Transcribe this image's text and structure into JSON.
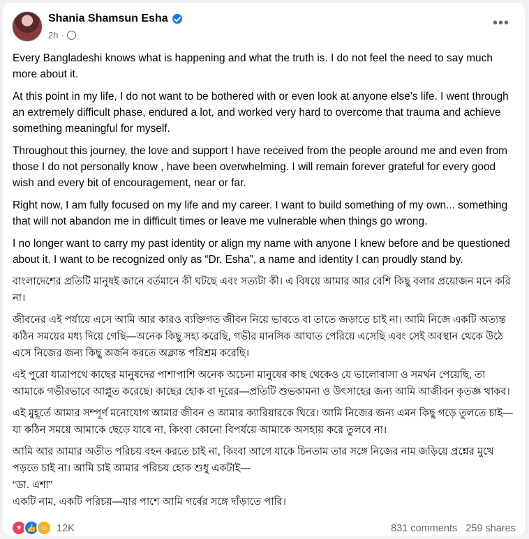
{
  "post": {
    "author": "Shania Shamsun Esha",
    "time": "2h",
    "separator": "·",
    "paragraphs_en": [
      "Every Bangladeshi knows what is happening and what the truth is. I do not feel the need to say much more about it.",
      "At this point in my life, I do not want to be bothered with or even look at anyone else’s life. I went through an extremely difficult phase, endured a lot, and worked very hard to overcome that trauma and achieve something meaningful for myself.",
      "Throughout this journey, the love and support I have received from the people around me and even from those I do not personally know , have been overwhelming. I will remain forever grateful for every good wish and every bit of encouragement, near or far.",
      "Right now, I am fully focused on my life and my career. I want to build something of my own... something that will not abandon me in difficult times or leave me vulnerable when things go wrong.",
      "I no longer want to carry my past identity or align my name with anyone I knew before  and be questioned about it. I want to be recognized only as “Dr. Esha”, a name and identity I can proudly stand by."
    ],
    "paragraphs_bn": [
      "বাংলাদেশের প্রতিটি মানুষই জানে বর্তমানে কী ঘটছে এবং সত্যটা কী। এ বিষয়ে আমার আর বেশি কিছু বলার প্রয়োজন মনে করি না।",
      "জীবনের এই পর্যায়ে এসে আমি আর কারও ব্যক্তিগত জীবন নিয়ে ভাবতে বা তাতে জড়াতে চাই না। আমি নিজে একটি অত্যন্ত কঠিন সময়ের মধ্য দিয়ে গেছি—অনেক কিছু সহ্য করেছি, গভীর মানসিক আঘাত পেরিয়ে এসেছি এবং সেই অবস্থান থেকে উঠে এসে নিজের জন্য কিছু অর্জন করতে অক্লান্ত পরিশ্রম করেছি।",
      "এই পুরো যাত্রাপথে কাছের মানুষদের পাশাপাশি অনেক অচেনা মানুষের কাছ থেকেও যে ভালোবাসা ও সমর্থন পেয়েছি, তা আমাকে গভীরভাবে আপ্লুত করেছে। কাছের হোক বা দূরের—প্রতিটি শুভকামনা ও উৎসাহের জন্য আমি আজীবন কৃতজ্ঞ থাকব।",
      "এই মুহূর্তে আমার সম্পূর্ণ মনোযোগ আমার জীবন ও আমার ক্যারিয়ারকে ঘিরে। আমি নিজের জন্য এমন কিছু গড়ে তুলতে চাই—যা কঠিন সময়ে আমাকে ছেড়ে যাবে না, কিংবা কোনো বিপর্যয়ে আমাকে অসহায় করে তুলবে না।",
      "আমি আর আমার অতীত পরিচয় বহন করতে চাই না, কিংবা আগে যাকে চিনতাম তার সঙ্গে নিজের নাম জড়িয়ে প্রশ্নের মুখে পড়তে চাই না। আমি চাই আমার পরিচয় হোক শুধু একটাই—\n“ডা. এশা”\nএকটি নাম, একটি পরিচয়—যার পাশে আমি গর্বের সঙ্গে দাঁড়াতে পারি।"
    ],
    "reaction_count": "12K",
    "comments": "831 comments",
    "shares": "259 shares"
  },
  "icons": {
    "more": "more-options-icon",
    "verified": "verified-badge-icon",
    "audience": "globe-icon",
    "reactions": [
      "love-reaction-icon",
      "like-reaction-icon",
      "care-reaction-icon"
    ]
  },
  "colors": {
    "brand": "#1877f2",
    "love": "#f33e58",
    "care": "#f7b125",
    "secondary_text": "#65676b"
  }
}
